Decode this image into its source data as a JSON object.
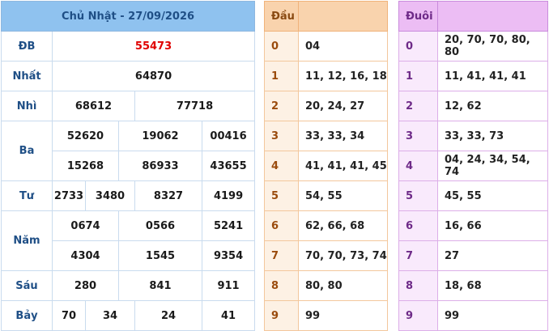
{
  "main": {
    "header": "Chủ Nhật - 27/09/2026",
    "prizes": {
      "db": {
        "label": "ĐB",
        "values": [
          "55473"
        ]
      },
      "nhat": {
        "label": "Nhất",
        "values": [
          "64870"
        ]
      },
      "nhi": {
        "label": "Nhì",
        "values": [
          "68612",
          "77718"
        ]
      },
      "ba": {
        "label": "Ba",
        "values": [
          "52620",
          "19062",
          "00416",
          "15268",
          "86933",
          "43655"
        ]
      },
      "tu": {
        "label": "Tư",
        "values": [
          "2733",
          "3480",
          "8327",
          "4199"
        ]
      },
      "nam": {
        "label": "Năm",
        "values": [
          "0674",
          "0566",
          "5241",
          "4304",
          "1545",
          "9354"
        ]
      },
      "sau": {
        "label": "Sáu",
        "values": [
          "280",
          "841",
          "911"
        ]
      },
      "bay": {
        "label": "Bảy",
        "values": [
          "70",
          "34",
          "24",
          "41"
        ]
      }
    }
  },
  "dau": {
    "header": "Đầu",
    "rows": [
      {
        "k": "0",
        "v": "04"
      },
      {
        "k": "1",
        "v": "11, 12, 16, 18"
      },
      {
        "k": "2",
        "v": "20, 24, 27"
      },
      {
        "k": "3",
        "v": "33, 33, 34"
      },
      {
        "k": "4",
        "v": "41, 41, 41, 45"
      },
      {
        "k": "5",
        "v": "54, 55"
      },
      {
        "k": "6",
        "v": "62, 66, 68"
      },
      {
        "k": "7",
        "v": "70, 70, 73, 74"
      },
      {
        "k": "8",
        "v": "80, 80"
      },
      {
        "k": "9",
        "v": "99"
      }
    ]
  },
  "duoi": {
    "header": "Đuôi",
    "rows": [
      {
        "k": "0",
        "v": "20, 70, 70, 80, 80"
      },
      {
        "k": "1",
        "v": "11, 41, 41, 41"
      },
      {
        "k": "2",
        "v": "12, 62"
      },
      {
        "k": "3",
        "v": "33, 33, 73"
      },
      {
        "k": "4",
        "v": "04, 24, 34, 54, 74"
      },
      {
        "k": "5",
        "v": "45, 55"
      },
      {
        "k": "6",
        "v": "16, 66"
      },
      {
        "k": "7",
        "v": "27"
      },
      {
        "k": "8",
        "v": "18, 68"
      },
      {
        "k": "9",
        "v": "99"
      }
    ]
  }
}
